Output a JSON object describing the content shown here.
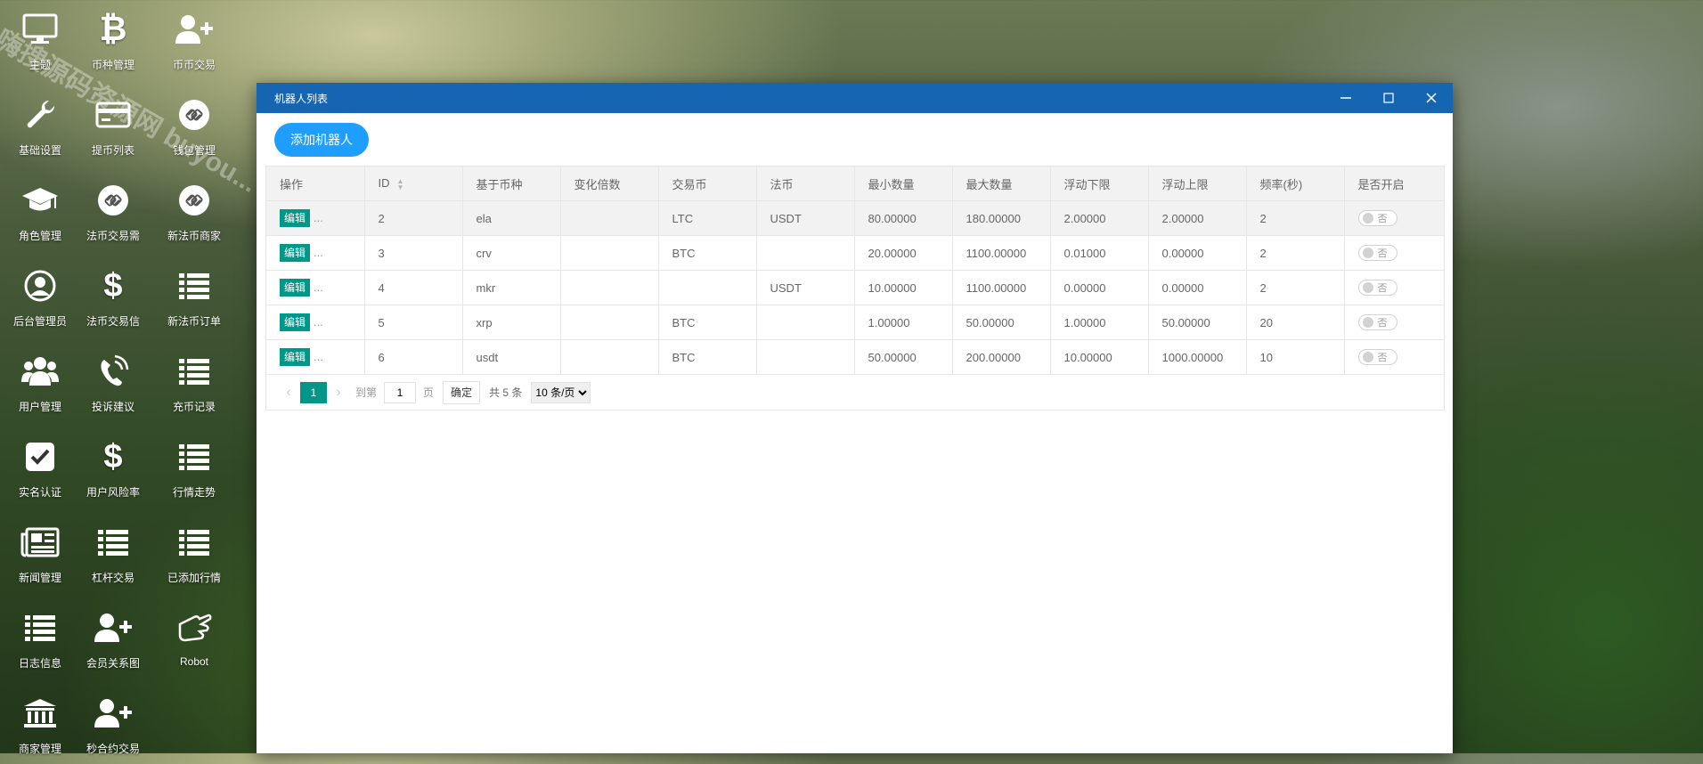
{
  "desktop": {
    "icons": [
      {
        "label": "主题",
        "icon": "monitor-icon"
      },
      {
        "label": "币种管理",
        "icon": "bitcoin-icon"
      },
      {
        "label": "币币交易",
        "icon": "user-plus-icon"
      },
      {
        "label": "基础设置",
        "icon": "wrench-icon"
      },
      {
        "label": "提币列表",
        "icon": "credit-card-icon"
      },
      {
        "label": "钱包管理",
        "icon": "chain-link-icon"
      },
      {
        "label": "角色管理",
        "icon": "graduation-cap-icon"
      },
      {
        "label": "法币交易需",
        "icon": "chain-link-icon"
      },
      {
        "label": "新法币商家",
        "icon": "chain-link-icon"
      },
      {
        "label": "后台管理员",
        "icon": "user-circle-icon"
      },
      {
        "label": "法币交易信",
        "icon": "dollar-icon"
      },
      {
        "label": "新法币订单",
        "icon": "list-icon"
      },
      {
        "label": "用户管理",
        "icon": "users-icon"
      },
      {
        "label": "投诉建议",
        "icon": "phone-icon"
      },
      {
        "label": "充币记录",
        "icon": "list-icon"
      },
      {
        "label": "实名认证",
        "icon": "check-square-icon"
      },
      {
        "label": "用户风险率",
        "icon": "dollar-icon"
      },
      {
        "label": "行情走势",
        "icon": "list-icon"
      },
      {
        "label": "新闻管理",
        "icon": "newspaper-icon"
      },
      {
        "label": "杠杆交易",
        "icon": "list-icon"
      },
      {
        "label": "已添加行情",
        "icon": "list-icon"
      },
      {
        "label": "日志信息",
        "icon": "list-icon"
      },
      {
        "label": "会员关系图",
        "icon": "user-plus-icon"
      },
      {
        "label": "Robot",
        "icon": "hand-peace-icon"
      },
      {
        "label": "商家管理",
        "icon": "bank-icon"
      },
      {
        "label": "秒合约交易",
        "icon": "user-plus-icon"
      }
    ],
    "watermark": "嗨搜源码资源网 buyou..."
  },
  "window": {
    "title": "机器人列表",
    "add_button": "添加机器人",
    "table": {
      "headers": [
        "操作",
        "ID",
        "基于币种",
        "变化倍数",
        "交易币",
        "法币",
        "最小数量",
        "最大数量",
        "浮动下限",
        "浮动上限",
        "频率(秒)",
        "是否开启"
      ],
      "edit_label": "编辑",
      "more_label": "...",
      "switch_label": "否",
      "rows": [
        {
          "id": "2",
          "base": "ela",
          "multiplier": "",
          "trade": "LTC",
          "fiat": "USDT",
          "min": "80.00000",
          "max": "180.00000",
          "low": "2.00000",
          "high": "2.00000",
          "freq": "2"
        },
        {
          "id": "3",
          "base": "crv",
          "multiplier": "",
          "trade": "BTC",
          "fiat": "",
          "min": "20.00000",
          "max": "1100.00000",
          "low": "0.01000",
          "high": "0.00000",
          "freq": "2"
        },
        {
          "id": "4",
          "base": "mkr",
          "multiplier": "",
          "trade": "",
          "fiat": "USDT",
          "min": "10.00000",
          "max": "1100.00000",
          "low": "0.00000",
          "high": "0.00000",
          "freq": "2"
        },
        {
          "id": "5",
          "base": "xrp",
          "multiplier": "",
          "trade": "BTC",
          "fiat": "",
          "min": "1.00000",
          "max": "50.00000",
          "low": "1.00000",
          "high": "50.00000",
          "freq": "20"
        },
        {
          "id": "6",
          "base": "usdt",
          "multiplier": "",
          "trade": "BTC",
          "fiat": "",
          "min": "50.00000",
          "max": "200.00000",
          "low": "10.00000",
          "high": "1000.00000",
          "freq": "10"
        }
      ]
    },
    "pager": {
      "current": "1",
      "goto_prefix": "到第",
      "goto_value": "1",
      "goto_suffix": "页",
      "confirm": "确定",
      "total": "共 5 条",
      "page_size": "10 条/页"
    }
  }
}
